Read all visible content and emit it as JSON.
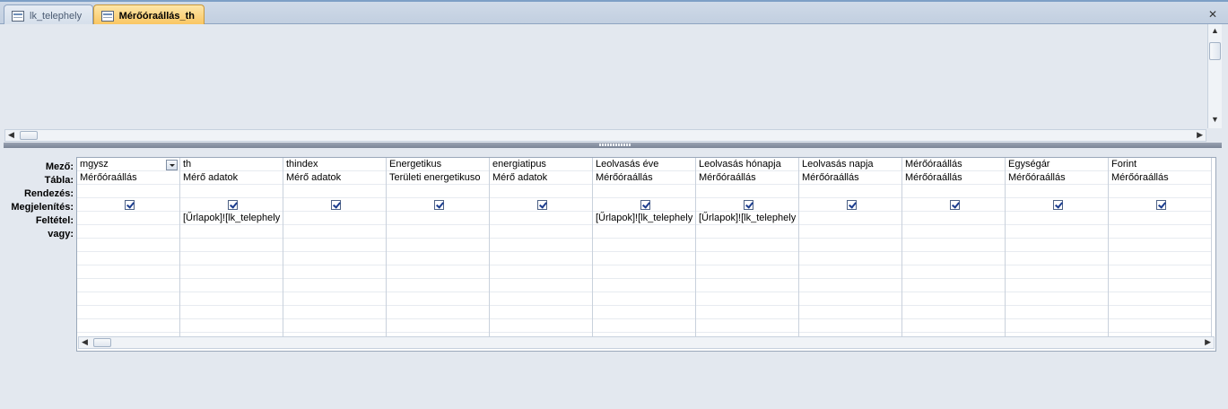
{
  "tabs": [
    {
      "label": "lk_telephely",
      "active": false
    },
    {
      "label": "Mérőóraállás_th",
      "active": true
    }
  ],
  "row_labels": [
    "Mező:",
    "Tábla:",
    "Rendezés:",
    "Megjelenítés:",
    "Feltétel:",
    "vagy:"
  ],
  "columns": [
    {
      "field": "mgysz",
      "table": "Mérőóraállás",
      "sort": "",
      "show": true,
      "criteria": "",
      "or": "",
      "has_dropdown": true
    },
    {
      "field": "th",
      "table": "Mérő adatok",
      "sort": "",
      "show": true,
      "criteria": "[Űrlapok]![lk_telephely",
      "or": ""
    },
    {
      "field": "thindex",
      "table": "Mérő adatok",
      "sort": "",
      "show": true,
      "criteria": "",
      "or": ""
    },
    {
      "field": "Energetikus",
      "table": "Területi energetikuso",
      "sort": "",
      "show": true,
      "criteria": "",
      "or": ""
    },
    {
      "field": "energiatipus",
      "table": "Mérő adatok",
      "sort": "",
      "show": true,
      "criteria": "",
      "or": ""
    },
    {
      "field": "Leolvasás éve",
      "table": "Mérőóraállás",
      "sort": "",
      "show": true,
      "criteria": "[Űrlapok]![lk_telephely",
      "or": ""
    },
    {
      "field": "Leolvasás hónapja",
      "table": "Mérőóraállás",
      "sort": "",
      "show": true,
      "criteria": "[Űrlapok]![lk_telephely",
      "or": ""
    },
    {
      "field": "Leolvasás napja",
      "table": "Mérőóraállás",
      "sort": "",
      "show": true,
      "criteria": "",
      "or": ""
    },
    {
      "field": "Mérőóraállás",
      "table": "Mérőóraállás",
      "sort": "",
      "show": true,
      "criteria": "",
      "or": ""
    },
    {
      "field": "Egységár",
      "table": "Mérőóraállás",
      "sort": "",
      "show": true,
      "criteria": "",
      "or": ""
    },
    {
      "field": "Forint",
      "table": "Mérőóraállás",
      "sort": "",
      "show": true,
      "criteria": "",
      "or": ""
    }
  ],
  "icons": {
    "close": "close-icon",
    "tab_query": "query-icon",
    "tab_form": "form-icon"
  }
}
